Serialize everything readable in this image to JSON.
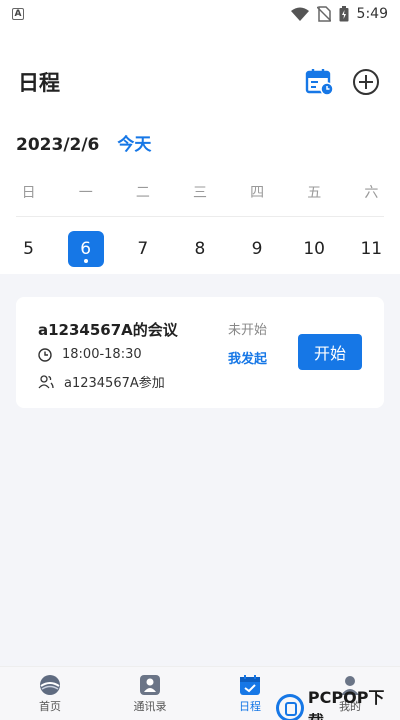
{
  "status_bar": {
    "time": "5:49",
    "app_indicator": "A"
  },
  "header": {
    "title": "日程"
  },
  "date": {
    "current": "2023/2/6",
    "today_label": "今天"
  },
  "weekdays": [
    "日",
    "一",
    "二",
    "三",
    "四",
    "五",
    "六"
  ],
  "days": [
    "5",
    "6",
    "7",
    "8",
    "9",
    "10",
    "11"
  ],
  "selected_day": "6",
  "meeting": {
    "title": "a1234567A的会议",
    "status": "未开始",
    "time": "18:00-18:30",
    "host_label": "我发起",
    "participants": "a1234567A参加",
    "start_label": "开始"
  },
  "nav": [
    {
      "label": "首页",
      "icon": "home-icon"
    },
    {
      "label": "通讯录",
      "icon": "contacts-icon"
    },
    {
      "label": "日程",
      "icon": "schedule-icon"
    },
    {
      "label": "我的",
      "icon": "profile-icon"
    }
  ],
  "watermark": {
    "text": "PCPOP下载"
  },
  "colors": {
    "accent": "#1677e6",
    "background": "#f4f5f9"
  }
}
